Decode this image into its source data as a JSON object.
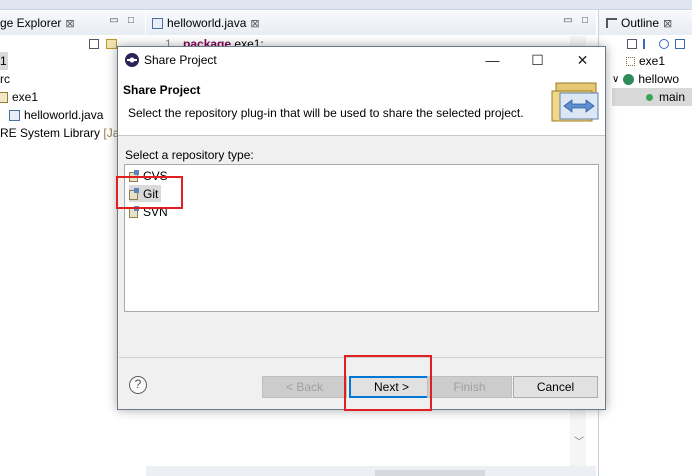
{
  "package_explorer": {
    "tab_label": "ge Explorer",
    "tab_close": "⊠",
    "tree": [
      {
        "label": "1"
      },
      {
        "label": "rc"
      },
      {
        "label": "exe1"
      },
      {
        "label": "helloworld.java"
      },
      {
        "label": "RE System Library",
        "suffix": "[Jav"
      }
    ]
  },
  "editor": {
    "tab_label": "helloworld.java",
    "tab_close": "⊠",
    "line_number": "1",
    "code_keyword": "package",
    "code_rest": "exe1;"
  },
  "outline": {
    "tab_label": "Outline",
    "tab_close": "⊠",
    "tree": [
      {
        "label": "exe1"
      },
      {
        "label": "hellowo"
      },
      {
        "label": "main"
      }
    ]
  },
  "window_controls": {
    "minimize": "▭",
    "maximize": "□"
  },
  "dialog": {
    "title": "Share Project",
    "minimize": "—",
    "maximize": "☐",
    "close": "✕",
    "header_title": "Share Project",
    "header_description": "Select the repository plug-in that will be used to share the selected project.",
    "list_label": "Select a repository type:",
    "repository_types": [
      {
        "label": "CVS",
        "selected": false
      },
      {
        "label": "Git",
        "selected": true
      },
      {
        "label": "SVN",
        "selected": false
      }
    ],
    "help_symbol": "?",
    "buttons": {
      "back": "< Back",
      "next": "Next >",
      "finish": "Finish",
      "cancel": "Cancel"
    }
  },
  "colors": {
    "highlight_red": "#e02020",
    "default_button_blue": "#0078d7",
    "keyword_purple": "#7f0055"
  }
}
